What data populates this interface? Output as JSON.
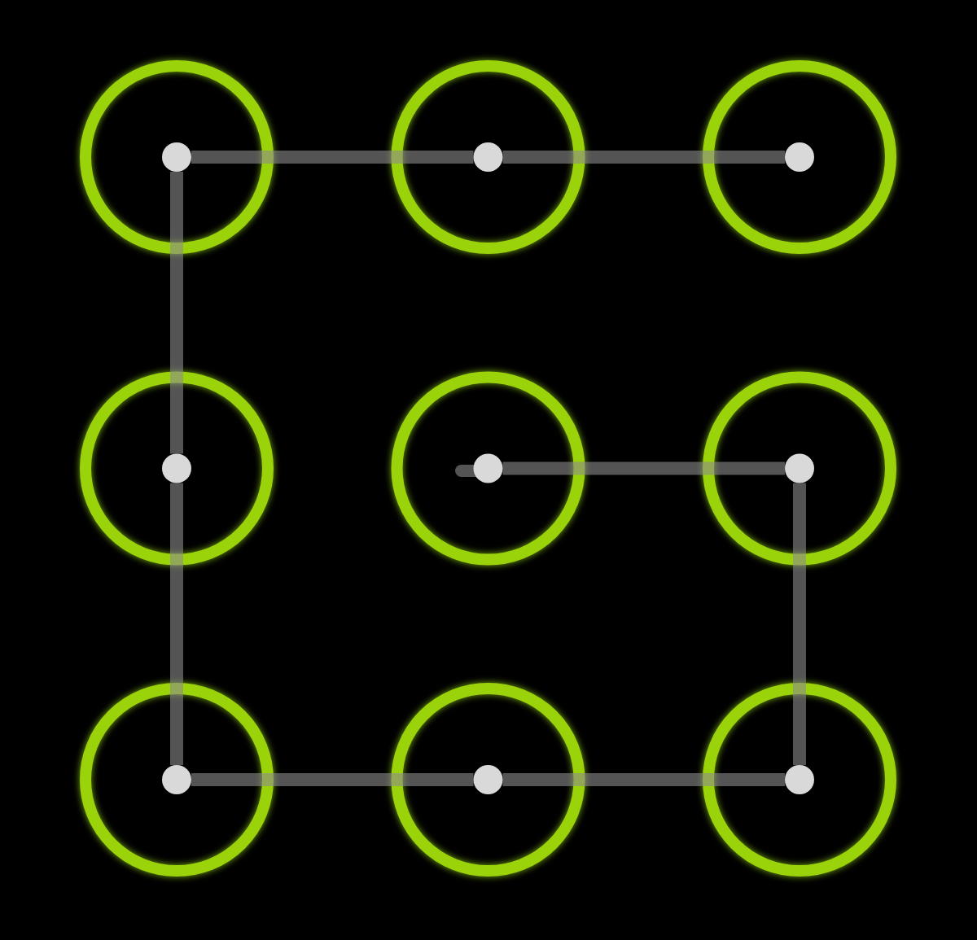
{
  "pattern_grid": {
    "rows": [
      {
        "nodes": [
          {
            "selected": true,
            "line_right": true,
            "line_down": true,
            "start": false
          },
          {
            "selected": true,
            "line_right": true,
            "line_down": false,
            "start": false
          },
          {
            "selected": true,
            "line_right": false,
            "line_down": false,
            "start": false
          }
        ]
      },
      {
        "nodes": [
          {
            "selected": true,
            "line_right": false,
            "line_down": true,
            "start": false
          },
          {
            "selected": true,
            "line_right": true,
            "line_down": false,
            "start": true
          },
          {
            "selected": true,
            "line_right": false,
            "line_down": true,
            "start": false
          }
        ]
      },
      {
        "nodes": [
          {
            "selected": true,
            "line_right": true,
            "line_down": false,
            "start": false
          },
          {
            "selected": true,
            "line_right": true,
            "line_down": false,
            "start": false
          },
          {
            "selected": true,
            "line_right": false,
            "line_down": false,
            "start": false
          }
        ]
      }
    ]
  }
}
